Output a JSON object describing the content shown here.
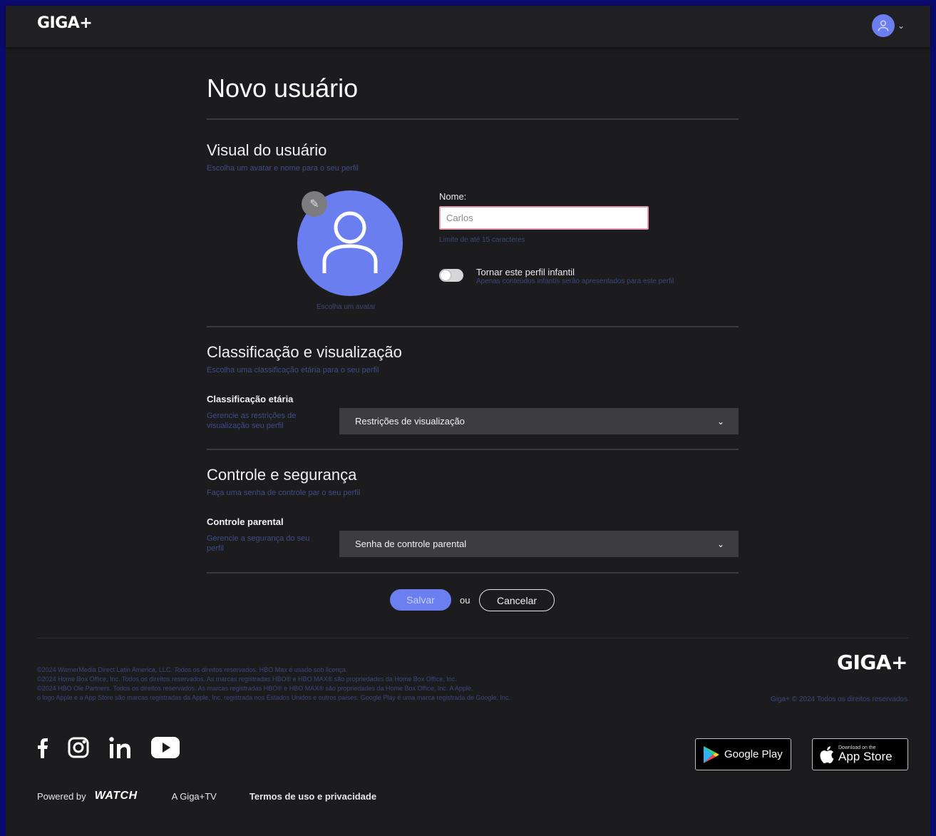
{
  "header": {
    "logo_text": "GIGA",
    "logo_plus": "+",
    "avatar_icon": "user-icon",
    "menu_chevron": "chevron-down-icon"
  },
  "page": {
    "title": "Novo usuário"
  },
  "visual_section": {
    "title": "Visual do usuário",
    "subtitle": "Escolha um avatar e nome para o seu perfil",
    "avatar_caption": "Escolha um avatar",
    "name_label": "Nome:",
    "name_value": "Carlos",
    "name_hint": "Limite de até 15 caracteres",
    "kid_toggle_label": "Tornar este perfil infantil",
    "kid_toggle_sub": "Apenas conteúdos infantis serão apresentados para este perfil",
    "kid_toggle_on": false
  },
  "rating_section": {
    "title": "Classificação e visualização",
    "subtitle": "Escolha uma classificação etária para o seu perfil",
    "row_label": "Classificação etária",
    "row_sub": "Gerencie as restrições de visualização seu perfil",
    "select_value": "Restrições de visualização"
  },
  "control_section": {
    "title": "Controle e segurança",
    "subtitle": "Faça uma senha de controle par o seu perfil",
    "row_label": "Controle parental",
    "row_sub": "Gerencie a segurança do seu perfil",
    "select_value": "Senha de controle parental"
  },
  "actions": {
    "save_label": "Salvar",
    "or_text": "ou",
    "cancel_label": "Cancelar"
  },
  "footer": {
    "legal_lines": [
      "©2024 WarnerMedia Direct Latin America, LLC. Todos os direitos reservados. HBO Max é usado sob licença.",
      "©2024 Home Box Office, Inc. Todos os direitos reservados. As marcas registradas HBO® e HBO MAX® são propriedades da Home Box Office, Inc.",
      "©2024 HBO Ole Partners. Todos os direitos reservados. As marcas registradas HBO® e HBO MAX® são propriedades da Home Box Office, Inc. A Apple,",
      "o logo Apple e a App Store são marcas registradas da Apple, Inc. registrada nos Estados Unidos e outros países. Google Play é uma marca registrada de Google, Inc."
    ],
    "copyright": "Giga+ © 2024 Todos os direitos reservados",
    "social": [
      "facebook-icon",
      "instagram-icon",
      "linkedin-icon",
      "youtube-icon"
    ],
    "google_play_label": "Google Play",
    "app_store_small": "Download on the",
    "app_store_label": "App Store",
    "powered_by": "Powered by",
    "watch_logo": "WATCH",
    "about_link": "A Giga+TV",
    "terms_link": "Termos de uso e privacidade"
  },
  "colors": {
    "accent": "#6b7ff0",
    "background": "#1c1c1f",
    "frame_border": "#0a0a6e"
  }
}
